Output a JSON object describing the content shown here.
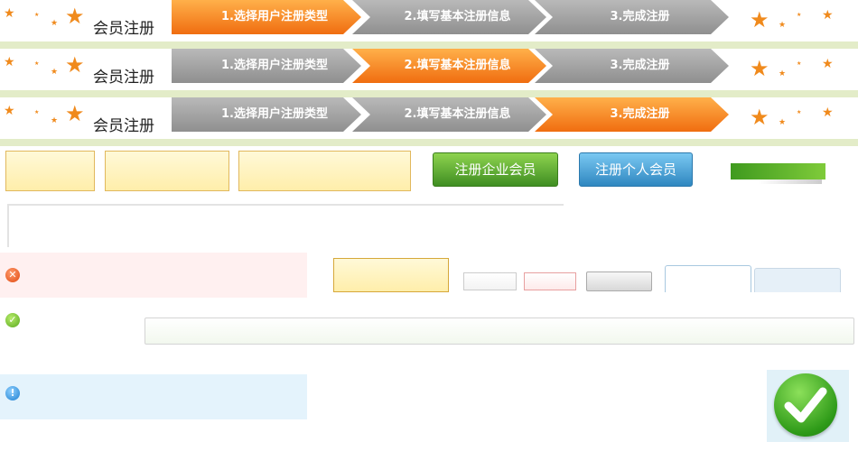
{
  "registration_banner": {
    "title": "会员注册",
    "steps": [
      "1.选择用户注册类型",
      "2.填写基本注册信息",
      "3.完成注册"
    ],
    "rows": [
      {
        "active_step": 1
      },
      {
        "active_step": 2
      },
      {
        "active_step": 3
      }
    ]
  },
  "buttons": {
    "enterprise_label": "注册企业会员",
    "personal_label": "注册个人会员"
  },
  "colors": {
    "accent_orange": "#f27a1a",
    "step_gray": "#9a9a9a",
    "enterprise_green": "#4a9e2a",
    "personal_blue": "#3b8fc4",
    "error_bg": "#fff0f0",
    "info_bg": "#e4f3fc"
  },
  "icons": {
    "error": "error-x-icon",
    "success": "check-icon",
    "info": "info-icon",
    "big_check": "big-checkmark-icon"
  }
}
